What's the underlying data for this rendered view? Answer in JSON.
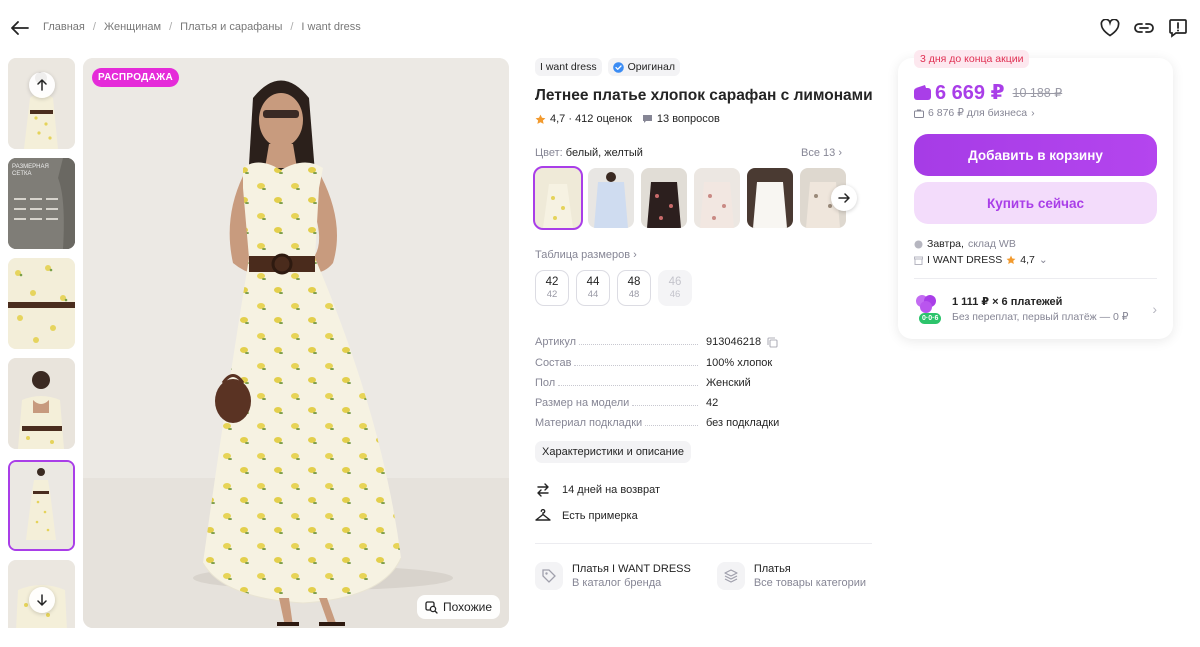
{
  "breadcrumb": [
    "Главная",
    "Женщинам",
    "Платья и сарафаны",
    "I want dress"
  ],
  "gallery": {
    "sale_badge": "РАСПРОДАЖА",
    "similar_label": "Похожие",
    "size_chart_thumb_label": "РАЗМЕРНАЯ СЕТКА"
  },
  "product": {
    "brand": "I want dress",
    "original_label": "Оригинал",
    "title": "Летнее платье хлопок сарафан с лимонами",
    "rating": "4,7 · 412 оценок",
    "questions": "13 вопросов",
    "color_label": "Цвет:",
    "color_value": "белый, желтый",
    "all_colors": "Все 13",
    "size_table_label": "Таблица размеров",
    "sizes": [
      {
        "main": "42",
        "sub": "42",
        "available": true
      },
      {
        "main": "44",
        "sub": "44",
        "available": true
      },
      {
        "main": "48",
        "sub": "48",
        "available": true
      },
      {
        "main": "46",
        "sub": "46",
        "available": false
      }
    ],
    "specs": [
      {
        "key": "Артикул",
        "value": "913046218"
      },
      {
        "key": "Состав",
        "value": "100% хлопок"
      },
      {
        "key": "Пол",
        "value": "Женский"
      },
      {
        "key": "Размер на модели",
        "value": "42"
      },
      {
        "key": "Материал подкладки",
        "value": "без подкладки"
      }
    ],
    "desc_button": "Характеристики и описание",
    "features": [
      "14 дней на возврат",
      "Есть примерка"
    ],
    "links": [
      {
        "title": "Платья I WANT DRESS",
        "sub": "В каталог бренда"
      },
      {
        "title": "Платья",
        "sub": "Все товары категории"
      }
    ]
  },
  "purchase": {
    "promo": "3 дня до конца акции",
    "price": "6 669 ₽",
    "old_price": "10 188 ₽",
    "business_price": "6 876 ₽ для бизнеса",
    "add_to_cart": "Добавить в корзину",
    "buy_now": "Купить сейчас",
    "delivery_when": "Завтра,",
    "delivery_where": "склад WB",
    "seller": "I WANT DRESS",
    "seller_rating": "4,7",
    "installment_title": "1 111 ₽ × 6 платежей",
    "installment_sub": "Без переплат, первый платёж — 0 ₽",
    "installment_badge": "0·0·6"
  },
  "colors": {
    "accent": "#a93ee8",
    "sale": "#e52bd9",
    "promo_text": "#e03053"
  }
}
